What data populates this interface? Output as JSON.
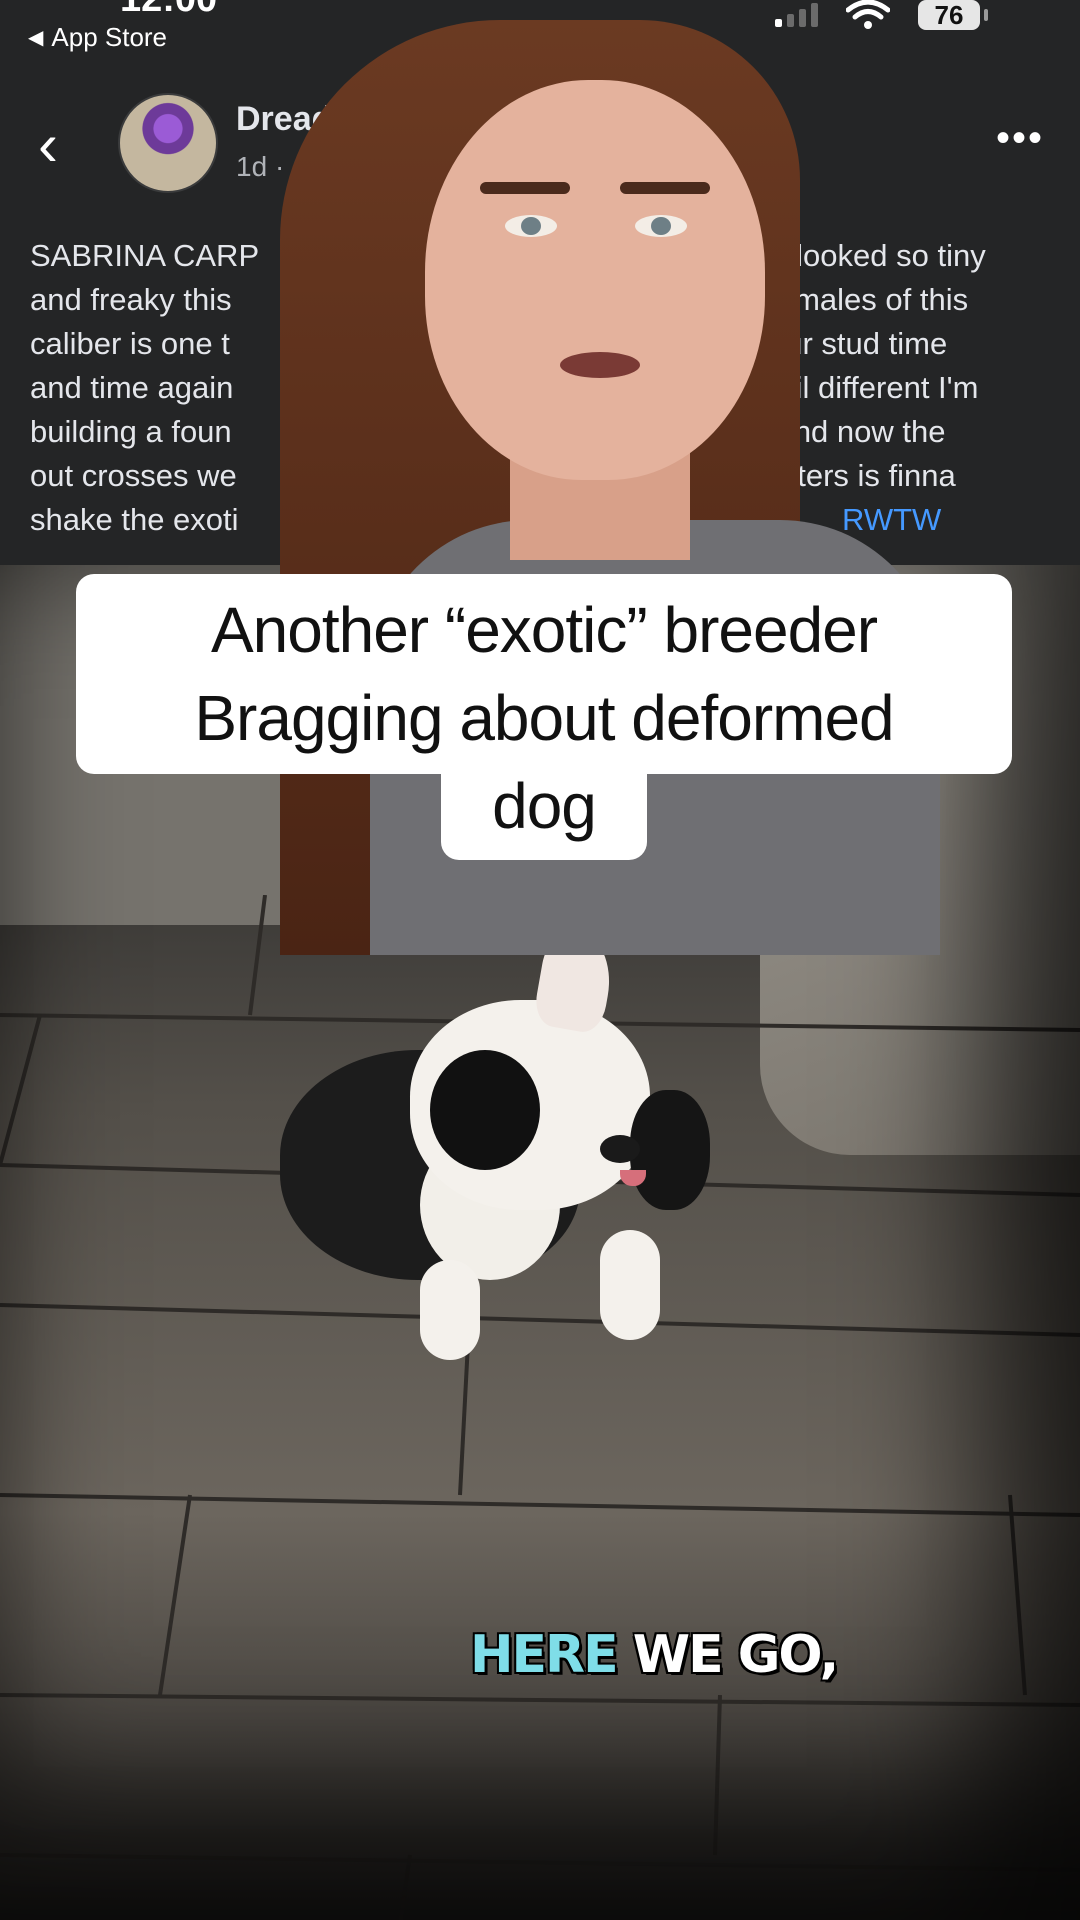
{
  "status_bar": {
    "time": "12:00",
    "back_app": "App Store",
    "battery": "76"
  },
  "post": {
    "author_name": "Dread",
    "meta_time": "1d",
    "text_lines": [
      {
        "left": "SABRINA CARP",
        "right": "never looked so tiny"
      },
      {
        "left": "and freaky this",
        "right": "wn females of this"
      },
      {
        "left": "caliber is one t",
        "right": "off your stud time"
      },
      {
        "left": "and time again",
        "right": "ist hits alil different I'm"
      },
      {
        "left": "building a foun",
        "right": "s blood and now the"
      },
      {
        "left": "out crosses we",
        "right": "hters is finna"
      },
      {
        "left": "shake the exoti",
        "right": "RWTW"
      }
    ]
  },
  "caption": {
    "text": "Another “exotic” breeder\nBragging about deformed\ndog"
  },
  "subtitle": {
    "part1": "HERE",
    "part2": "WE GO,"
  }
}
